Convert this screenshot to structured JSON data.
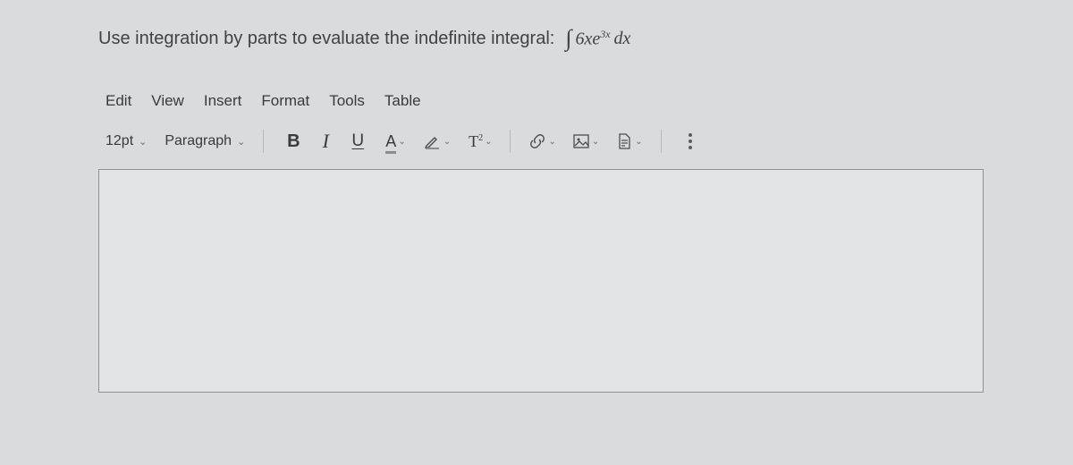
{
  "question": {
    "prefix": "Use integration by parts to evaluate the indefinite integral:",
    "math_integral": "∫",
    "math_coeff": "6",
    "math_var1": "x",
    "math_e": "e",
    "math_exp_coeff": "3",
    "math_exp_var": "x",
    "math_dvar": "dx"
  },
  "menubar": {
    "items": [
      "Edit",
      "View",
      "Insert",
      "Format",
      "Tools",
      "Table"
    ]
  },
  "toolbar": {
    "font_size": "12pt",
    "block_format": "Paragraph",
    "bold_label": "B",
    "italic_label": "I",
    "underline_label": "U",
    "textcolor_label": "A",
    "superscript_label_T": "T",
    "superscript_label_2": "2"
  }
}
